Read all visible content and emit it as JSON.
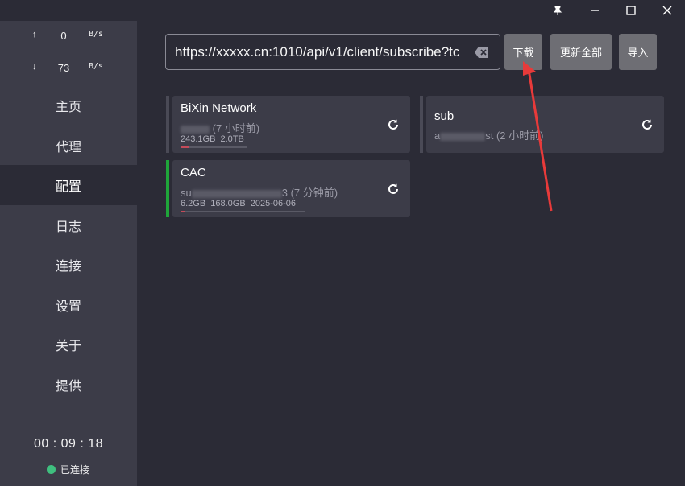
{
  "titlebar": {
    "icons": [
      "pin-icon",
      "minimize-icon",
      "maximize-icon",
      "close-icon"
    ]
  },
  "traffic": {
    "up": {
      "arrow": "↑",
      "value": "0",
      "unit": "B/s"
    },
    "down": {
      "arrow": "↓",
      "value": "73",
      "unit": "B/s"
    }
  },
  "nav": [
    {
      "label": "主页"
    },
    {
      "label": "代理"
    },
    {
      "label": "配置"
    },
    {
      "label": "日志"
    },
    {
      "label": "连接"
    },
    {
      "label": "设置"
    },
    {
      "label": "关于"
    },
    {
      "label": "提供"
    }
  ],
  "active_nav": "配置",
  "timer": "00 : 09 : 18",
  "status_label": "已连接",
  "url_value": "https://xxxxx.cn:1010/api/v1/client/subscribe?tc",
  "buttons": {
    "download": "下载",
    "update_all": "更新全部",
    "import": "导入"
  },
  "profiles": [
    {
      "title": "BiXin Network",
      "sub_suffix": " (7 小时前)",
      "stats": "243.1GB  2.0TB",
      "used_fraction": 0.12,
      "active": false
    },
    {
      "title": "sub",
      "sub_prefix": "a",
      "sub_suffix": "st (2 小时前)",
      "stats": "",
      "active": false
    },
    {
      "title": "CAC",
      "sub_prefix": "su",
      "sub_suffix": "3 (7 分钟前)",
      "stats": "6.2GB  168.0GB  2025-06-06",
      "used_fraction": 0.04,
      "active": true
    }
  ],
  "colors": {
    "accent_active": "#1fa53a",
    "status_dot": "#3fbf7f",
    "annotation": "#e83a3a"
  }
}
